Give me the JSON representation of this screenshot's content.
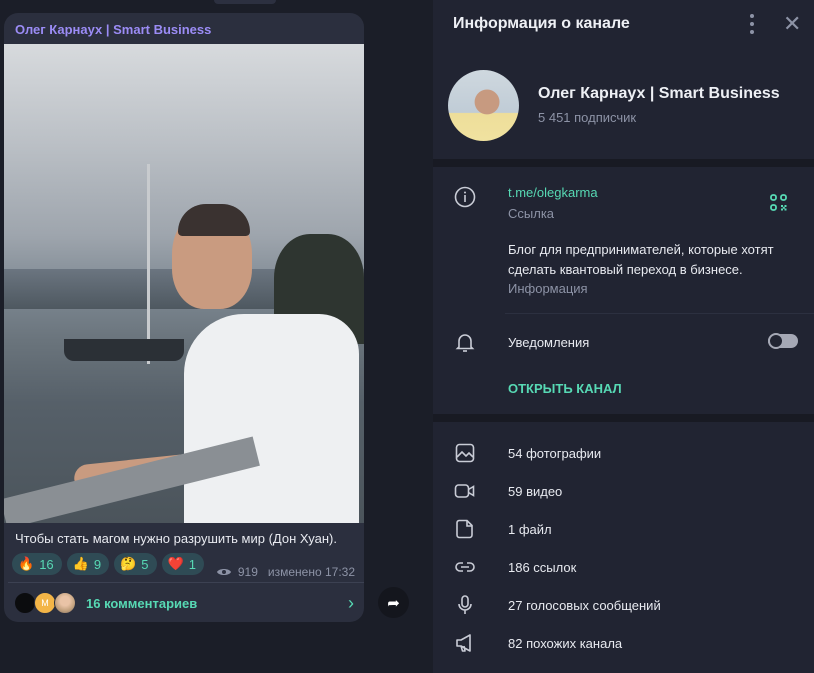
{
  "message": {
    "author": "Олег Карнаух | Smart Business",
    "caption": "Чтобы стать магом нужно разрушить мир (Дон Хуан).",
    "reactions": [
      {
        "emoji": "🔥",
        "count": "16"
      },
      {
        "emoji": "👍",
        "count": "9"
      },
      {
        "emoji": "🤔",
        "count": "5"
      },
      {
        "emoji": "❤️",
        "count": "1"
      }
    ],
    "views": "919",
    "edited": "изменено 17:32",
    "commenter_initial": "М",
    "comments": "16 комментариев"
  },
  "panel": {
    "title": "Информация о канале",
    "channel_name": "Олег Карнаух | Smart Business",
    "subscribers": "5 451 подписчик",
    "link": "t.me/olegkarma",
    "link_label": "Ссылка",
    "description": "Блог для предпринимателей, которые хотят сделать квантовый переход в бизнесе.",
    "description_label": "Информация",
    "notifications": "Уведомления",
    "notifications_on": false,
    "open_channel": "ОТКРЫТЬ КАНАЛ",
    "media": [
      {
        "icon": "photo-icon",
        "label": "54 фотографии"
      },
      {
        "icon": "video-icon",
        "label": "59 видео"
      },
      {
        "icon": "file-icon",
        "label": "1 файл"
      },
      {
        "icon": "link-icon",
        "label": "186 ссылок"
      },
      {
        "icon": "microphone-icon",
        "label": "27 голосовых сообщений"
      },
      {
        "icon": "megaphone-icon",
        "label": "82 похожих канала"
      }
    ]
  },
  "colors": {
    "accent": "#57d9b4",
    "author": "#9b8cf5",
    "panel_bg": "#212432",
    "bubble_bg": "#2b2f3e"
  }
}
